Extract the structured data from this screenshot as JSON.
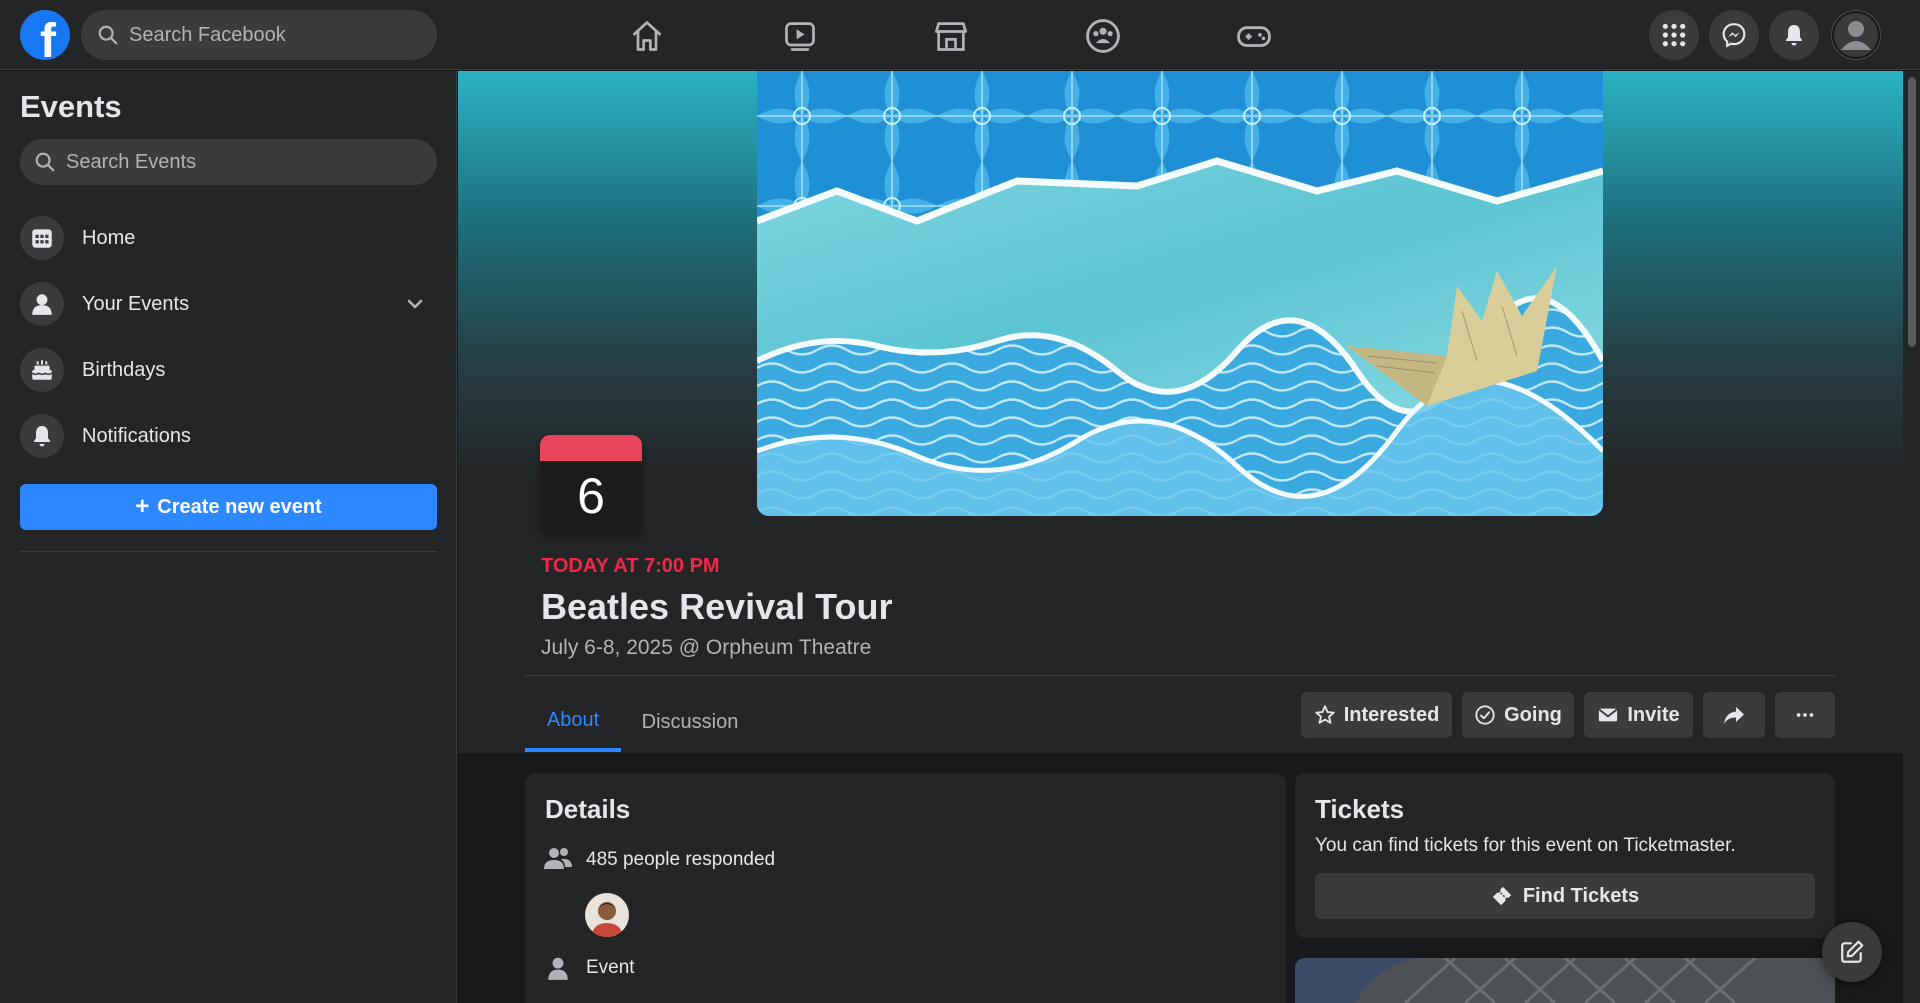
{
  "topbar": {
    "logo_letter": "f",
    "search_placeholder": "Search Facebook",
    "nav": [
      "home-icon",
      "watch-icon",
      "marketplace-icon",
      "groups-icon",
      "gaming-icon"
    ],
    "right": [
      "menu-grid-icon",
      "messenger-icon",
      "notifications-icon",
      "profile-avatar"
    ]
  },
  "sidebar": {
    "title": "Events",
    "search_placeholder": "Search Events",
    "items": [
      {
        "label": "Home",
        "icon": "calendar-icon"
      },
      {
        "label": "Your Events",
        "icon": "person-icon"
      },
      {
        "label": "Birthdays",
        "icon": "cake-icon"
      },
      {
        "label": "Notifications",
        "icon": "bell-icon"
      }
    ],
    "create_label": "Create new event"
  },
  "event": {
    "day": "6",
    "when": "TODAY AT 7:00 PM",
    "title": "Beatles Revival Tour",
    "subtitle": "July 6-8, 2025 @ Orpheum Theatre"
  },
  "tabs": [
    {
      "label": "About",
      "active": true
    },
    {
      "label": "Discussion",
      "active": false
    }
  ],
  "actions": {
    "interested": "Interested",
    "going": "Going",
    "invite": "Invite",
    "share_icon": "share-icon",
    "more_icon": "more-icon"
  },
  "details": {
    "heading": "Details",
    "responded": "485 people responded",
    "type": "Event"
  },
  "tickets": {
    "heading": "Tickets",
    "text": "You can find tickets for this event on Ticketmaster.",
    "button": "Find Tickets"
  },
  "colors": {
    "accent": "#2d88ff",
    "date_red": "#f02849",
    "surface": "#242526",
    "background": "#18191a"
  }
}
